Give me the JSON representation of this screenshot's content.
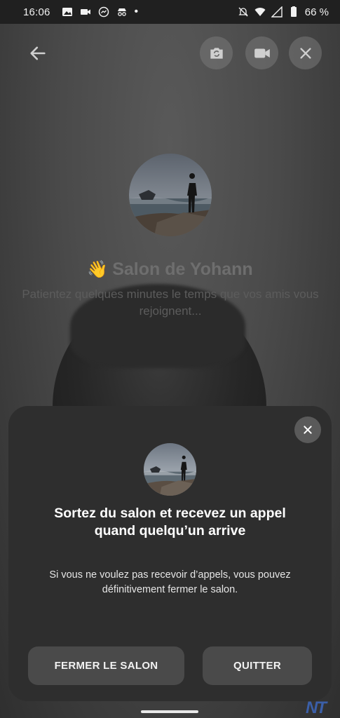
{
  "status_bar": {
    "time": "16:06",
    "battery": "66 %"
  },
  "room": {
    "wave_emoji": "👋",
    "title": "Salon de Yohann",
    "subtitle": "Patientez quelques minutes le temps que vos amis vous rejoignent..."
  },
  "sheet": {
    "title": "Sortez du salon et recevez un appel quand quelqu’un arrive",
    "body": "Si vous ne voulez pas recevoir d’appels, vous pouvez définitivement fermer le salon.",
    "close_room_label": "FERMER LE SALON",
    "quit_label": "QUITTER"
  },
  "icons": {
    "back": "arrow-back-icon",
    "flip": "camera-flip-icon",
    "video": "video-camera-icon",
    "close": "close-icon"
  },
  "watermark": "NT"
}
